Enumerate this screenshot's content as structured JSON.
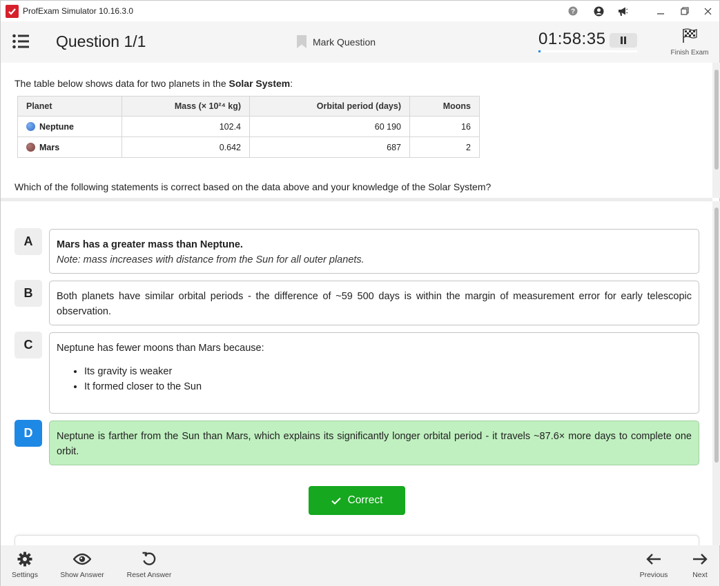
{
  "window": {
    "title": "ProfExam Simulator 10.16.3.0"
  },
  "header": {
    "question_title": "Question 1/1",
    "mark_label": "Mark Question",
    "timer": "01:58:35",
    "timer_progress": 0.01,
    "finish_label": "Finish Exam"
  },
  "question": {
    "intro_text": "The table below shows data for two planets in the ",
    "intro_bold": "Solar System",
    "intro_end": ":",
    "table": {
      "headers": [
        "Planet",
        "Mass (× 10²⁴ kg)",
        "Orbital period (days)",
        "Moons"
      ],
      "rows": [
        {
          "planet": "Neptune",
          "color": "#3f7fd6",
          "mass": "102.4",
          "period": "60 190",
          "moons": "16"
        },
        {
          "planet": "Mars",
          "color": "#8a4a48",
          "mass": "0.642",
          "period": "687",
          "moons": "2"
        }
      ]
    },
    "prompt": "Which of the following statements is correct based on the data above and your knowledge of the Solar System?"
  },
  "options": {
    "a": {
      "letter": "A",
      "main": "Mars has a greater mass than Neptune.",
      "note": "Note: mass increases with distance from the Sun for all outer planets."
    },
    "b": {
      "letter": "B",
      "text": "Both planets have similar orbital periods - the difference of ~59 500 days is within the margin of measurement error for early telescopic observation."
    },
    "c": {
      "letter": "C",
      "text": "Neptune has fewer moons than Mars because:",
      "bullets": [
        "Its gravity is weaker",
        "It formed closer to the Sun"
      ]
    },
    "d": {
      "letter": "D",
      "text": "Neptune is farther from the Sun than Mars, which explains its significantly longer orbital period - it travels ~87.6× more days to complete one orbit."
    }
  },
  "result": {
    "label": "Correct"
  },
  "footer": {
    "settings": "Settings",
    "show_answer": "Show Answer",
    "reset_answer": "Reset Answer",
    "previous": "Previous",
    "next": "Next"
  },
  "colors": {
    "accent": "#1e88e5",
    "correct_bg": "#c0f0c0",
    "correct_button": "#16a81e",
    "logo": "#d6202b"
  },
  "icons": [
    "app-logo-icon",
    "help-icon",
    "account-icon",
    "announce-icon",
    "minimize-icon",
    "restore-icon",
    "close-icon",
    "menu-list-icon",
    "bookmark-icon",
    "pause-icon",
    "finish-flag-icon",
    "check-icon",
    "gear-icon",
    "eye-icon",
    "reset-icon",
    "arrow-left-icon",
    "arrow-right-icon"
  ]
}
